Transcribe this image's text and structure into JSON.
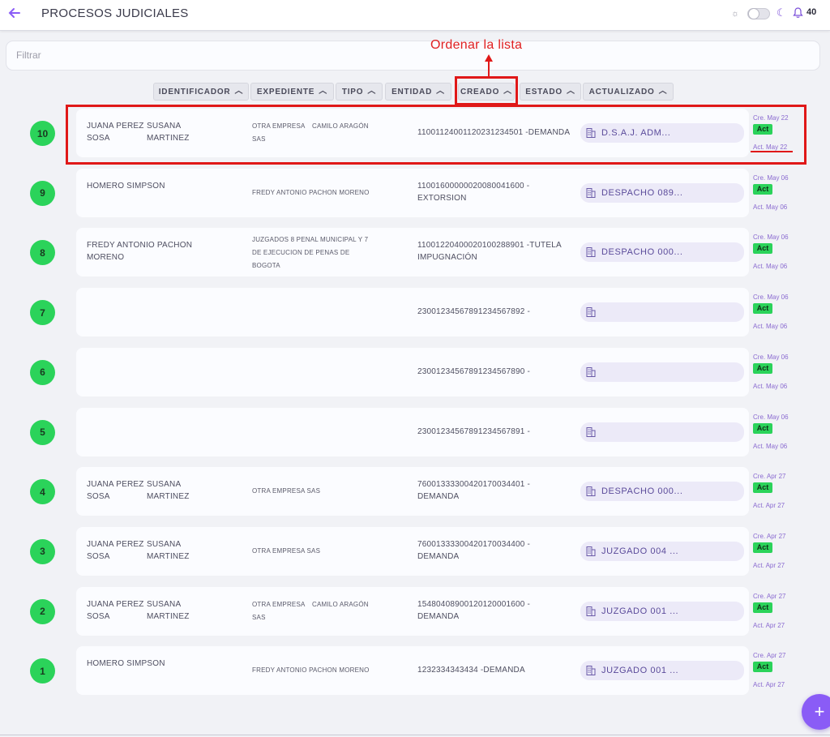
{
  "header": {
    "title": "PROCESOS JUDICIALES",
    "notification_count": "40"
  },
  "filter": {
    "placeholder": "Filtrar"
  },
  "annotation": {
    "label": "Ordenar la lista"
  },
  "sort_buttons": [
    {
      "label": "IDENTIFICADOR"
    },
    {
      "label": "EXPEDIENTE"
    },
    {
      "label": "TIPO"
    },
    {
      "label": "ENTIDAD"
    },
    {
      "label": "CREADO"
    },
    {
      "label": "ESTADO"
    },
    {
      "label": "ACTUALIZADO"
    }
  ],
  "rows": [
    {
      "num": "10",
      "party_a1": "JUANA PEREZ",
      "party_a2": "SOSA",
      "party_b1": "SUSANA",
      "party_b2": "MARTINEZ",
      "counter_1": "OTRA EMPRESA",
      "counter_1b": "SAS",
      "counter_2": "CAMILO ARAGÓN",
      "expediente_1": "11001124001120231234501 -DEMANDA",
      "expediente_2": "",
      "entity": "D.S.A.J. ADM...",
      "created": "Cre. May 22",
      "status": "Act",
      "updated": "Act. May 22"
    },
    {
      "num": "9",
      "party_a1": "HOMERO SIMPSON",
      "party_a2": "",
      "party_b1": "",
      "party_b2": "",
      "counter_1": "FREDY ANTONIO PACHON MORENO",
      "counter_1b": "",
      "counter_2": "",
      "expediente_1": "11001600000020080041600 -",
      "expediente_2": "EXTORSION",
      "entity": "DESPACHO 089...",
      "created": "Cre. May 06",
      "status": "Act",
      "updated": "Act. May 06"
    },
    {
      "num": "8",
      "party_a1": "FREDY ANTONIO PACHON",
      "party_a2": "MORENO",
      "party_b1": "",
      "party_b2": "",
      "counter_1": "JUZGADOS 8 PENAL MUNICIPAL Y 7",
      "counter_1b": "DE EJECUCION DE PENAS DE",
      "counter_1c": "BOGOTA",
      "counter_2": "",
      "expediente_1": "11001220400020100288901 -TUTELA",
      "expediente_2": "IMPUGNACIÓN",
      "entity": "DESPACHO 000...",
      "created": "Cre. May 06",
      "status": "Act",
      "updated": "Act. May 06"
    },
    {
      "num": "7",
      "party_a1": "",
      "party_a2": "",
      "party_b1": "",
      "party_b2": "",
      "counter_1": "",
      "counter_1b": "",
      "counter_2": "",
      "expediente_1": "230012345678912345678​92 -",
      "expediente_2": "",
      "entity": "",
      "created": "Cre. May 06",
      "status": "Act",
      "updated": "Act. May 06"
    },
    {
      "num": "6",
      "party_a1": "",
      "party_a2": "",
      "party_b1": "",
      "party_b2": "",
      "counter_1": "",
      "counter_1b": "",
      "counter_2": "",
      "expediente_1": "23001234567891234567890 -",
      "expediente_2": "",
      "entity": "",
      "created": "Cre. May 06",
      "status": "Act",
      "updated": "Act. May 06"
    },
    {
      "num": "5",
      "party_a1": "",
      "party_a2": "",
      "party_b1": "",
      "party_b2": "",
      "counter_1": "",
      "counter_1b": "",
      "counter_2": "",
      "expediente_1": "23001234567891234567891 -",
      "expediente_2": "",
      "entity": "",
      "created": "Cre. May 06",
      "status": "Act",
      "updated": "Act. May 06"
    },
    {
      "num": "4",
      "party_a1": "JUANA PEREZ",
      "party_a2": "SOSA",
      "party_b1": "SUSANA",
      "party_b2": "MARTINEZ",
      "counter_1": "OTRA EMPRESA SAS",
      "counter_1b": "",
      "counter_2": "",
      "expediente_1": "76001333300420170034401 -",
      "expediente_2": "DEMANDA",
      "entity": "DESPACHO 000...",
      "created": "Cre. Apr 27",
      "status": "Act",
      "updated": "Act. Apr 27"
    },
    {
      "num": "3",
      "party_a1": "JUANA PEREZ",
      "party_a2": "SOSA",
      "party_b1": "SUSANA",
      "party_b2": "MARTINEZ",
      "counter_1": "OTRA EMPRESA SAS",
      "counter_1b": "",
      "counter_2": "",
      "expediente_1": "76001333300420170034400 -",
      "expediente_2": "DEMANDA",
      "entity": "JUZGADO 004 ...",
      "created": "Cre. Apr 27",
      "status": "Act",
      "updated": "Act. Apr 27"
    },
    {
      "num": "2",
      "party_a1": "JUANA PEREZ",
      "party_a2": "SOSA",
      "party_b1": "SUSANA",
      "party_b2": "MARTINEZ",
      "counter_1": "OTRA EMPRESA",
      "counter_1b": "SAS",
      "counter_2": "CAMILO ARAGÓN",
      "expediente_1": "15480408900120120001600 -",
      "expediente_2": "DEMANDA",
      "entity": "JUZGADO 001 ...",
      "created": "Cre. Apr 27",
      "status": "Act",
      "updated": "Act. Apr 27"
    },
    {
      "num": "1",
      "party_a1": "HOMERO SIMPSON",
      "party_a2": "",
      "party_b1": "",
      "party_b2": "",
      "counter_1": "FREDY ANTONIO PACHON MORENO",
      "counter_1b": "",
      "counter_2": "",
      "expediente_1": "1232334343434 -DEMANDA",
      "expediente_2": "",
      "entity": "JUZGADO 001 ...",
      "created": "Cre. Apr 27",
      "status": "Act",
      "updated": "Act. Apr 27"
    }
  ],
  "colors": {
    "accent": "#8a5cf6",
    "status_green": "#2bd35a",
    "annotation_red": "#e01818"
  },
  "icons": {
    "back": "arrow-left-icon",
    "theme_light": "sun-icon",
    "theme_dark": "moon-icon",
    "notifications": "bell-icon",
    "entity": "building-icon",
    "fab": "plus-icon"
  }
}
